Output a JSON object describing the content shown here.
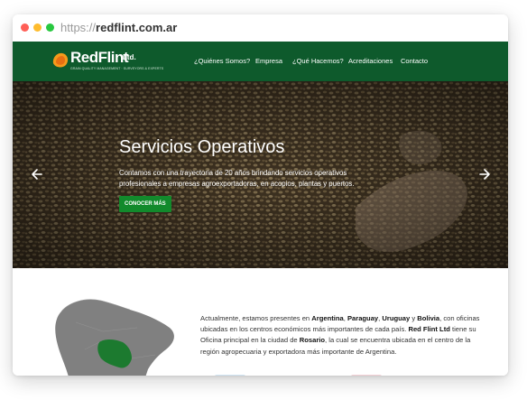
{
  "browser": {
    "url_scheme": "https://",
    "url_host": "redflint.com.ar"
  },
  "brand": {
    "name": "RedFlint",
    "suffix": "Ltd.",
    "tagline": "GRAIN QUALITY MANAGEMENT · SURVEYORS & EXPERTS",
    "nav_bg": "#0e5a2c",
    "accent": "#128a2c"
  },
  "nav": {
    "items": [
      {
        "label": "¿Quiénes Somos?"
      },
      {
        "label": "Empresa"
      },
      {
        "label": "¿Qué Hacemos?"
      },
      {
        "label": "Acreditaciones"
      },
      {
        "label": "Contacto"
      }
    ]
  },
  "hero": {
    "title": "Servicios Operativos",
    "text": "Contamos con una trayectoria de 20 años brindando servicios operativos profesionales a empresas agroexportadoras, en acopios, plantas y puertos.",
    "button_label": "CONOCER MÁS",
    "prev_icon": "arrow-left-icon",
    "next_icon": "arrow-right-icon"
  },
  "about": {
    "p1": "Actualmente, estamos presentes en ",
    "country1": "Argentina",
    "sep1": ", ",
    "country2": "Paraguay",
    "sep2": ", ",
    "country3": "Uruguay",
    "sep3": " y ",
    "country4": "Bolivia",
    "p2": ", con oficinas ubicadas en los centros económicos más importantes de cada país. ",
    "company": "Red Flint Ltd",
    "p3": " tiene su Oficina principal en la ciudad de ",
    "city": "Rosario",
    "p4": ", la cual se encuentra ubicada en el centro de la región agropecuaria y exportadora más importante de Argentina."
  }
}
